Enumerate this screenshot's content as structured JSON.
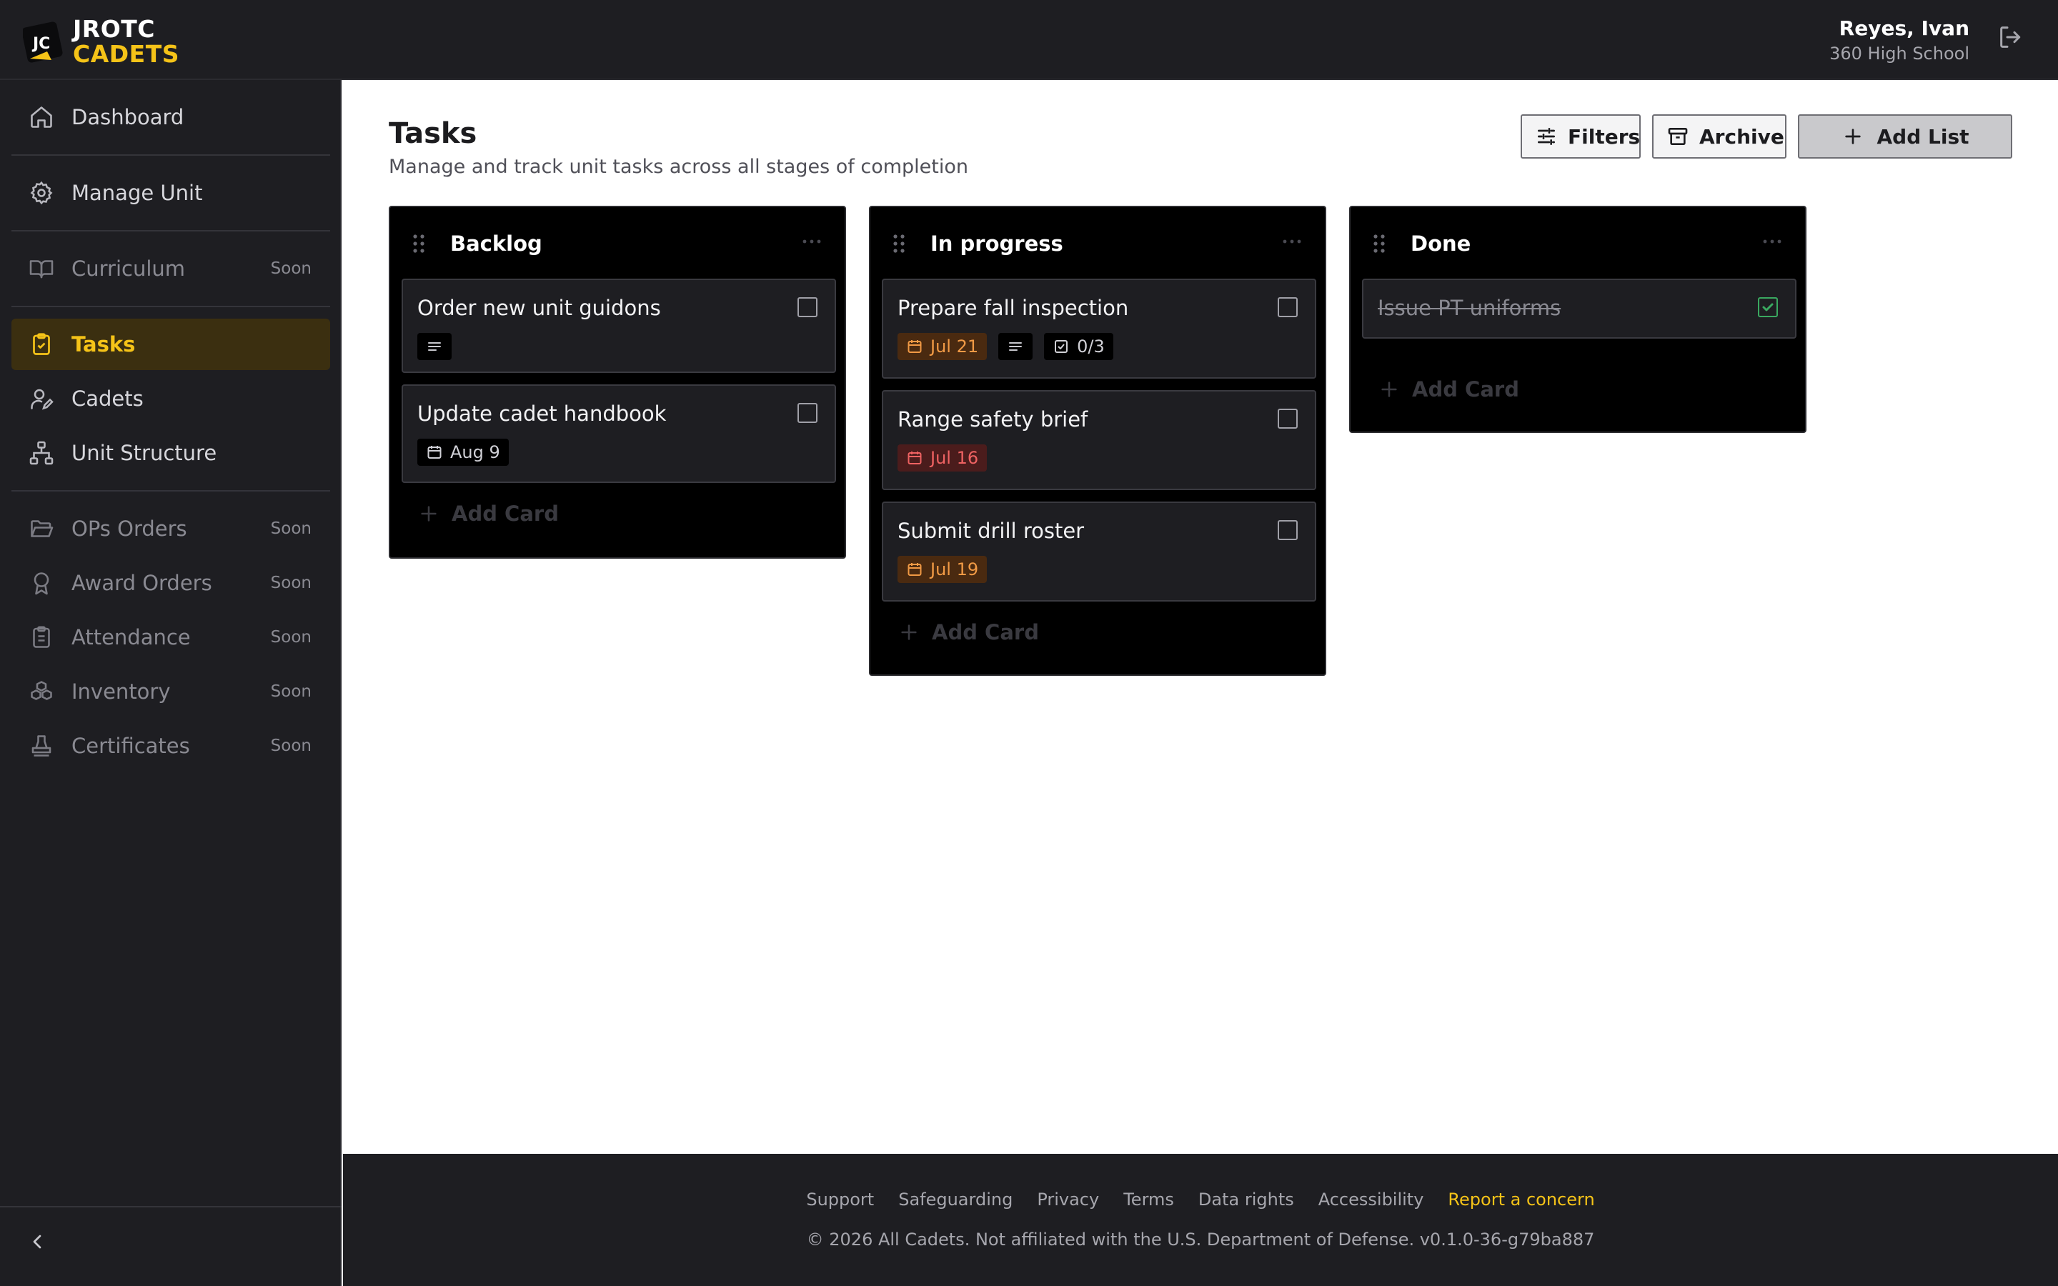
{
  "brand": {
    "badge": "JC",
    "line1": "JROTC",
    "line2": "CADETS"
  },
  "user": {
    "name": "Reyes, Ivan",
    "school": "360 High School"
  },
  "sidebar": {
    "items": [
      {
        "label": "Dashboard",
        "icon": "home-icon"
      },
      {
        "label": "Manage Unit",
        "icon": "gear-icon"
      },
      {
        "label": "Curriculum",
        "icon": "book-icon",
        "badge": "Soon"
      },
      {
        "label": "Tasks",
        "icon": "clipboard-icon",
        "active": true
      },
      {
        "label": "Cadets",
        "icon": "user-edit-icon"
      },
      {
        "label": "Unit Structure",
        "icon": "org-chart-icon"
      },
      {
        "label": "OPs Orders",
        "icon": "folder-open-icon",
        "badge": "Soon"
      },
      {
        "label": "Award Orders",
        "icon": "award-icon",
        "badge": "Soon"
      },
      {
        "label": "Attendance",
        "icon": "clipboard-list-icon",
        "badge": "Soon"
      },
      {
        "label": "Inventory",
        "icon": "boxes-icon",
        "badge": "Soon"
      },
      {
        "label": "Certificates",
        "icon": "stamp-icon",
        "badge": "Soon"
      }
    ]
  },
  "page": {
    "title": "Tasks",
    "subtitle": "Manage and track unit tasks across all stages of completion"
  },
  "toolbar": {
    "filters": "Filters",
    "archive": "Archive",
    "add_list": "Add List"
  },
  "board": {
    "add_card": "Add Card",
    "columns": [
      {
        "title": "Backlog",
        "cards": [
          {
            "title": "Order new unit guidons",
            "has_description": true,
            "done": false
          },
          {
            "title": "Update cadet handbook",
            "due": "Aug 9",
            "due_status": "normal",
            "done": false
          }
        ]
      },
      {
        "title": "In progress",
        "cards": [
          {
            "title": "Prepare fall inspection",
            "due": "Jul 21",
            "due_status": "soon",
            "has_description": true,
            "checklist": "0/3",
            "done": false
          },
          {
            "title": "Range safety brief",
            "due": "Jul 16",
            "due_status": "overdue",
            "done": false
          },
          {
            "title": "Submit drill roster",
            "due": "Jul 19",
            "due_status": "soon",
            "done": false
          }
        ]
      },
      {
        "title": "Done",
        "cards": [
          {
            "title": "Issue PT uniforms",
            "done": true
          }
        ]
      }
    ]
  },
  "footer": {
    "links": [
      "Support",
      "Safeguarding",
      "Privacy",
      "Terms",
      "Data rights",
      "Accessibility"
    ],
    "report": "Report a concern",
    "copyright": "© 2026 All Cadets. Not affiliated with the U.S. Department of Defense. v0.1.0-36-g79ba887"
  },
  "colors": {
    "accent": "#f5c318",
    "due_soon": "#f19a45",
    "overdue": "#ef6262",
    "done_check": "#3aa860"
  }
}
